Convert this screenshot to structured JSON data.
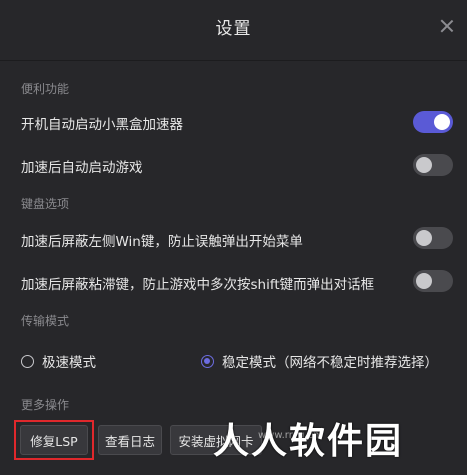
{
  "dialog": {
    "title": "设置"
  },
  "sections": {
    "convenience": {
      "title": "便利功能",
      "items": [
        {
          "label": "开机自动启动小黑盒加速器",
          "enabled": true
        },
        {
          "label": "加速后自动启动游戏",
          "enabled": false
        }
      ]
    },
    "keyboard": {
      "title": "键盘选项",
      "items": [
        {
          "label": "加速后屏蔽左侧Win键，防止误触弹出开始菜单",
          "enabled": false
        },
        {
          "label": "加速后屏蔽粘滞键，防止游戏中多次按shift键而弹出对话框",
          "enabled": false
        }
      ]
    },
    "transport": {
      "title": "传输模式",
      "options": [
        {
          "label": "极速模式",
          "selected": false
        },
        {
          "label": "稳定模式（网络不稳定时推荐选择）",
          "selected": true
        }
      ]
    },
    "more": {
      "title": "更多操作",
      "buttons": [
        {
          "label": "修复LSP"
        },
        {
          "label": "查看日志"
        },
        {
          "label": "安装虚拟网卡"
        }
      ]
    }
  },
  "watermark": {
    "text": "人人软件园",
    "sub": "www.rrcg.cn"
  },
  "colors": {
    "accent": "#5a5ad6",
    "background": "#27272a",
    "highlight_border": "#e0282c"
  },
  "icons": {
    "close": "close-icon"
  }
}
